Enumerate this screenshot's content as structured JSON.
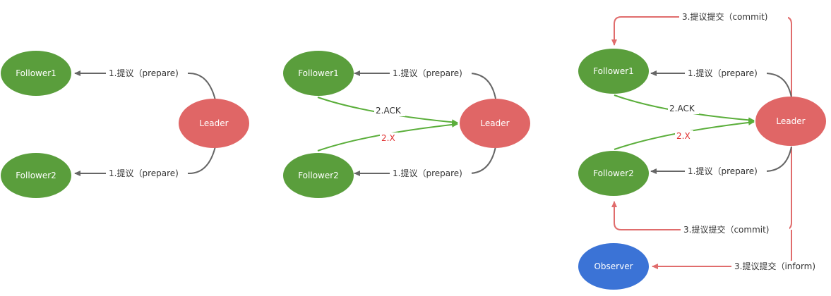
{
  "colors": {
    "follower": "#5a9e3c",
    "leader": "#e06666",
    "observer": "#3b73d6",
    "arrow_gray": "#666666",
    "arrow_green": "#5aae3a",
    "arrow_red": "#e06c6c",
    "x_label": "#e03030"
  },
  "panels": [
    {
      "nodes": {
        "follower1": "Follower1",
        "follower2": "Follower2",
        "leader": "Leader"
      },
      "edges": {
        "propose_f1": "1.提议（prepare)",
        "propose_f2": "1.提议（prepare)"
      }
    },
    {
      "nodes": {
        "follower1": "Follower1",
        "follower2": "Follower2",
        "leader": "Leader"
      },
      "edges": {
        "propose_f1": "1.提议（prepare)",
        "propose_f2": "1.提议（prepare)",
        "ack": "2.ACK",
        "x": "2.X"
      }
    },
    {
      "nodes": {
        "follower1": "Follower1",
        "follower2": "Follower2",
        "leader": "Leader",
        "observer": "Observer"
      },
      "edges": {
        "propose_f1": "1.提议（prepare)",
        "propose_f2": "1.提议（prepare)",
        "ack": "2.ACK",
        "x": "2.X",
        "commit_f1": "3.提议提交（commit)",
        "commit_f2": "3.提议提交（commit)",
        "inform_observer": "3.提议提交（inform)"
      }
    }
  ]
}
